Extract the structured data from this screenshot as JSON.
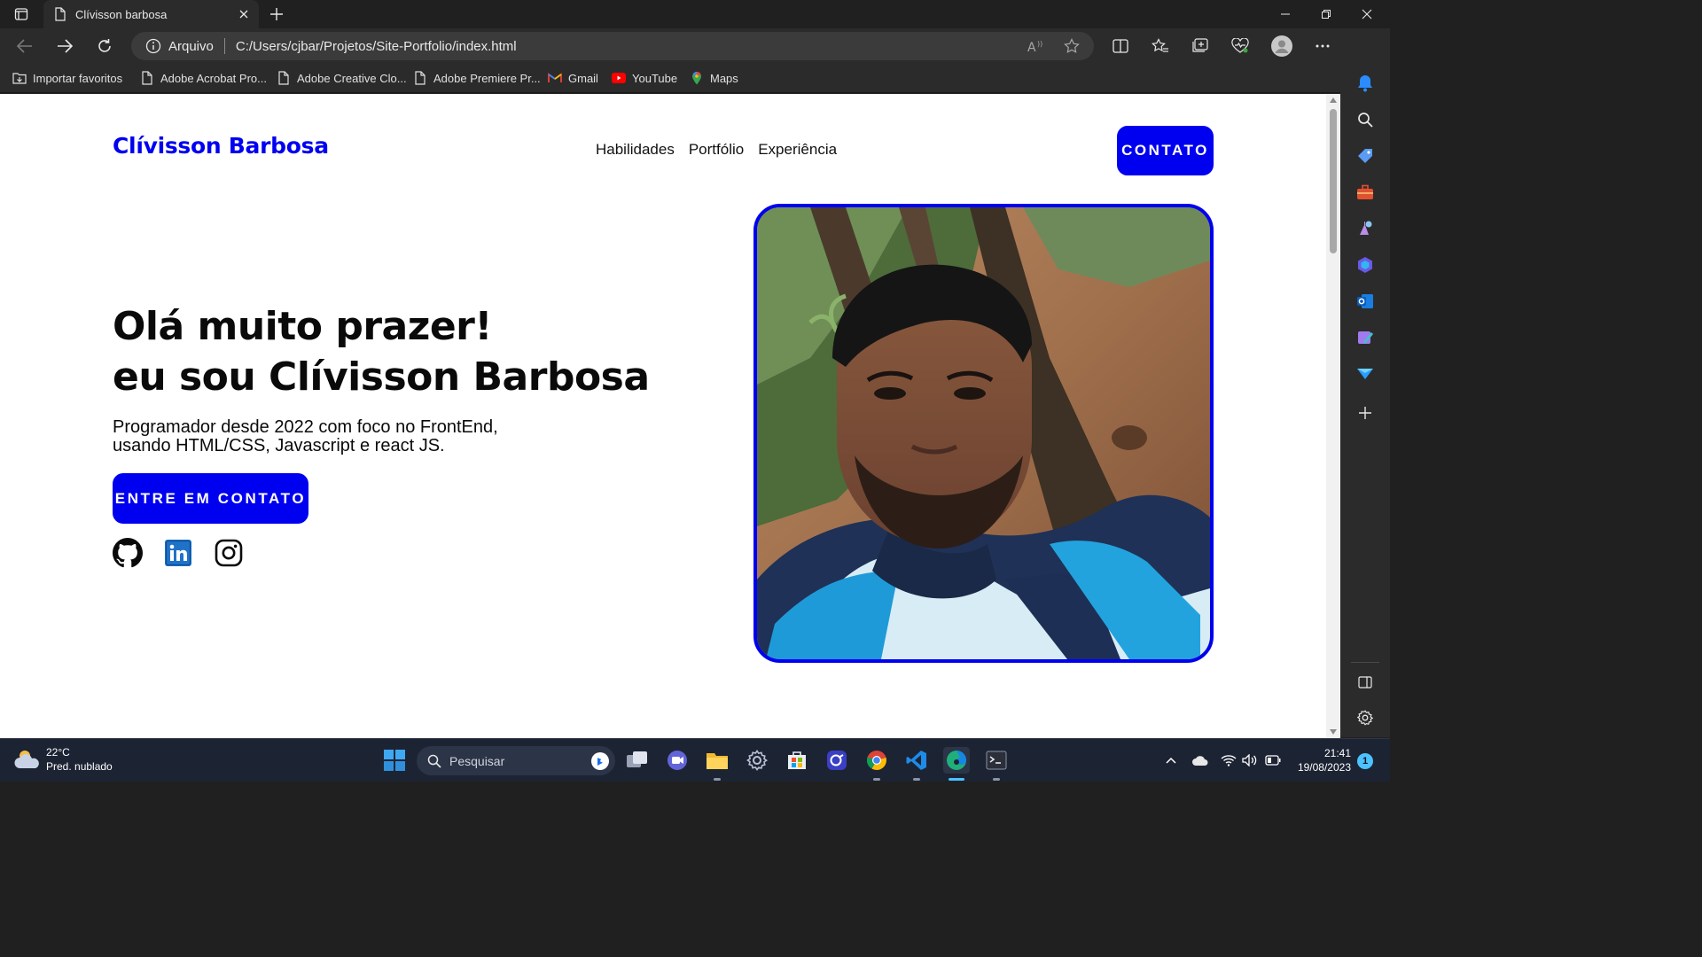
{
  "browser": {
    "tab_title": "Clívisson barbosa",
    "address_site_label": "Arquivo",
    "address_url": "C:/Users/cjbar/Projetos/Site-Portfolio/index.html"
  },
  "bookmarks": [
    {
      "label": "Importar favoritos",
      "icon": "import-favorites-icon"
    },
    {
      "label": "Adobe Acrobat Pro...",
      "icon": "page-icon"
    },
    {
      "label": "Adobe Creative Clo...",
      "icon": "page-icon"
    },
    {
      "label": "Adobe Premiere Pr...",
      "icon": "page-icon"
    },
    {
      "label": "Gmail",
      "icon": "gmail-icon"
    },
    {
      "label": "YouTube",
      "icon": "youtube-icon"
    },
    {
      "label": "Maps",
      "icon": "maps-pin-icon"
    }
  ],
  "page": {
    "logo": "Clívisson Barbosa",
    "nav": [
      "Habilidades",
      "Portfólio",
      "Experiência"
    ],
    "contact_button": "CONTATO",
    "hero_title_line1": "Olá muito prazer!",
    "hero_title_line2": "eu sou Clívisson Barbosa",
    "hero_sub_line1": "Programador desde 2022 com foco no FrontEnd,",
    "hero_sub_line2": "usando HTML/CSS, Javascript e react JS.",
    "cta_button": "ENTRE EM CONTATO",
    "socials": [
      "github-icon",
      "linkedin-icon",
      "instagram-icon"
    ],
    "accent_color": "#0000f0"
  },
  "taskbar": {
    "temperature": "22°C",
    "weather_desc": "Pred. nublado",
    "search_placeholder": "Pesquisar",
    "time": "21:41",
    "date": "19/08/2023",
    "notification_count": "1"
  }
}
